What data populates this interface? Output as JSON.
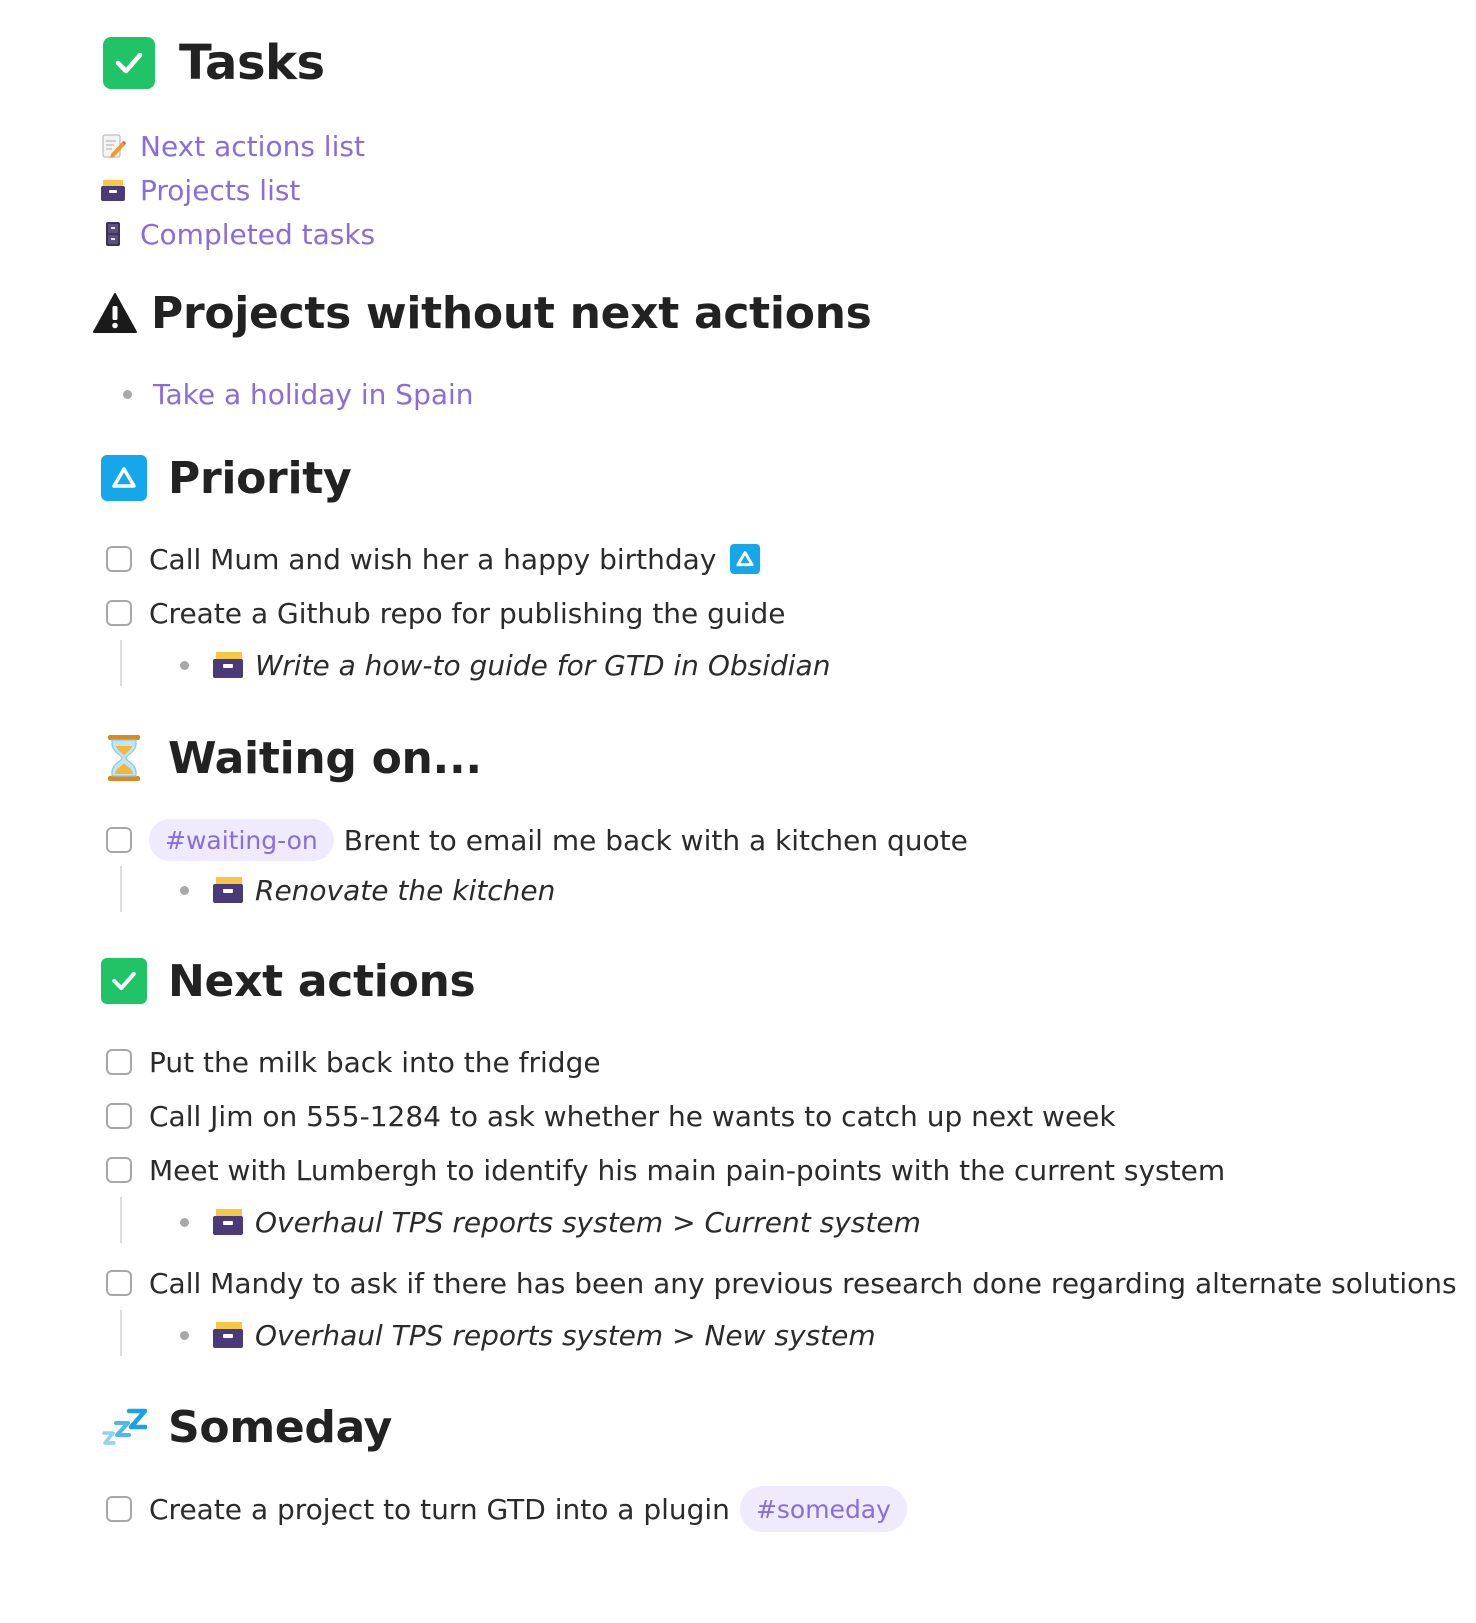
{
  "page": {
    "title": "Tasks",
    "title_icon": "check-box-icon"
  },
  "links": [
    {
      "icon": "memo-icon",
      "label": "Next actions list"
    },
    {
      "icon": "card-file-box-icon",
      "label": "Projects list"
    },
    {
      "icon": "file-cabinet-icon",
      "label": "Completed tasks"
    }
  ],
  "sections": {
    "no_next": {
      "heading": "Projects without next actions",
      "icon": "warning-icon",
      "items": [
        "Take a holiday in Spain"
      ]
    },
    "priority": {
      "heading": "Priority",
      "icon": "up-button-icon",
      "tasks": [
        {
          "text": "Call Mum and wish her a happy birthday"
        },
        {
          "text": "Create a Github repo for publishing the guide",
          "project": "Write a how-to guide for GTD in Obsidian"
        }
      ]
    },
    "waiting": {
      "heading": "Waiting on...",
      "icon": "hourglass-icon",
      "tasks": [
        {
          "tag": "#waiting-on",
          "text": "Brent to email me back with a kitchen quote",
          "project": "Renovate the kitchen"
        }
      ]
    },
    "next": {
      "heading": "Next actions",
      "icon": "check-box-icon",
      "tasks": [
        {
          "text": "Put the milk back into the fridge"
        },
        {
          "text": "Call Jim on 555-1284 to ask whether he wants to catch up next week"
        },
        {
          "text": "Meet with Lumbergh to identify his main pain-points with the current system",
          "project": "Overhaul TPS reports system > Current system"
        },
        {
          "text": "Call Mandy to ask if there has been any previous research done regarding alternate solutions",
          "project": "Overhaul TPS reports system > New system"
        }
      ]
    },
    "someday": {
      "heading": "Someday",
      "icon": "zzz-icon",
      "tasks": [
        {
          "text": "Create a project to turn GTD into a plugin",
          "tag": "#someday"
        }
      ]
    }
  },
  "colors": {
    "link": "#8b6cdc",
    "tag_bg": "#efeafc",
    "check_green": "#20c466",
    "priority_blue": "#14a7ea"
  }
}
